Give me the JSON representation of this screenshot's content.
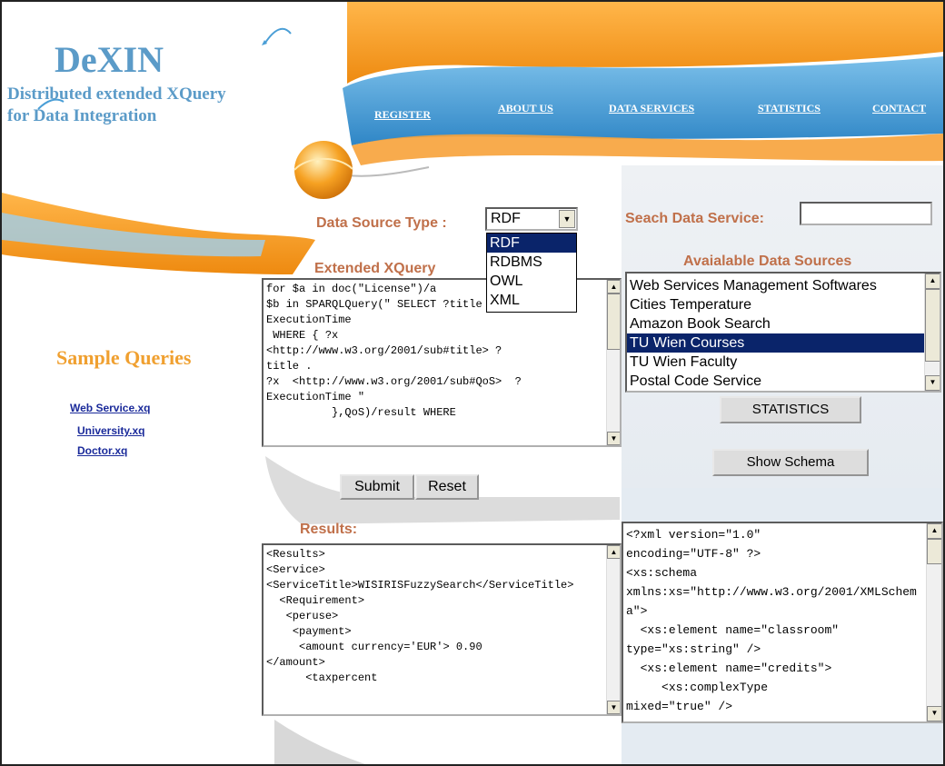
{
  "brand": {
    "title": "DeXIN",
    "subtitle": "Distributed extended XQuery for Data Integration"
  },
  "nav": {
    "items": [
      "REGISTER",
      "ABOUT US",
      "DATA SERVICES",
      "STATISTICS",
      "CONTACT"
    ]
  },
  "sidebar": {
    "heading": "Sample Queries",
    "queries": [
      "Web Service.xq",
      "University.xq",
      "Doctor.xq"
    ]
  },
  "data_source": {
    "label": "Data Source Type :",
    "selected": "RDF",
    "options": [
      "RDF",
      "RDBMS",
      "OWL",
      "XML"
    ],
    "highlighted": "RDF"
  },
  "xquery": {
    "label": "Extended XQuery",
    "text": "for $a in doc(\"License\")/a\n$b in SPARQLQuery(\" SELECT ?title ?\nExecutionTime\n WHERE { ?x\n<http://www.w3.org/2001/sub#title> ?\ntitle .\n?x  <http://www.w3.org/2001/sub#QoS>  ?\nExecutionTime \"\n          },QoS)/result WHERE"
  },
  "actions": {
    "submit": "Submit",
    "reset": "Reset"
  },
  "results": {
    "label": "Results:",
    "text": "<Results>\n<Service>\n<ServiceTitle>WISIRISFuzzySearch</ServiceTitle>\n  <Requirement>\n   <peruse>\n    <payment>\n     <amount currency='EUR'> 0.90\n</amount>\n      <taxpercent"
  },
  "search": {
    "label": "Seach Data Service:",
    "value": ""
  },
  "sources": {
    "label": "Avaialable Data Sources",
    "items": [
      "Web Services Management Softwares",
      "Cities Temperature",
      "Amazon Book Search",
      "TU Wien Courses",
      "TU Wien Faculty",
      "Postal Code Service"
    ],
    "selected": "TU Wien Courses"
  },
  "buttons": {
    "statistics": "STATISTICS",
    "show_schema": "Show Schema"
  },
  "schema": {
    "text": "<?xml version=\"1.0\"\nencoding=\"UTF-8\" ?>\n<xs:schema\nxmlns:xs=\"http://www.w3.org/2001/XMLSchema\">\n  <xs:element name=\"classroom\"\ntype=\"xs:string\" />\n  <xs:element name=\"credits\">\n     <xs:complexType\nmixed=\"true\" />"
  },
  "colors": {
    "orange": "#f39b1b",
    "blue": "#4a9ed6",
    "label": "#c0704a",
    "brand": "#5b9bc8"
  }
}
